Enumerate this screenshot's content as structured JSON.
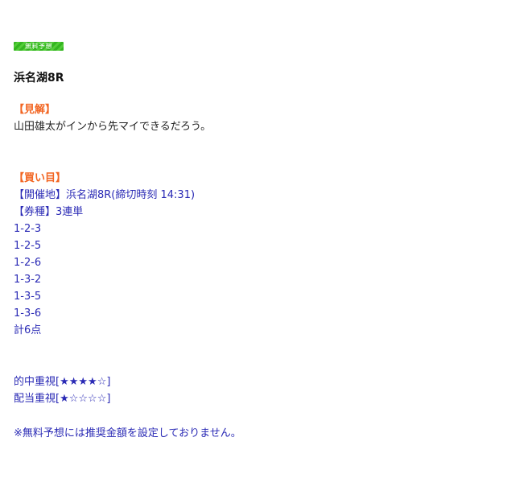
{
  "badge": {
    "label": "無料予想"
  },
  "race_title": "浜名湖8R",
  "colors": {
    "accent_orange": "#f26522",
    "text_blue": "#2a2ab5",
    "badge_green": "#3ebc26"
  },
  "opinion": {
    "heading": "【見解】",
    "text": "山田雄太がインから先マイできるだろう。"
  },
  "bets": {
    "heading": "【買い目】",
    "venue": "【開催地】浜名湖8R(締切時刻 14:31)",
    "ticket_type": "【券種】3連単",
    "combos": [
      "1-2-3",
      "1-2-5",
      "1-2-6",
      "1-3-2",
      "1-3-5",
      "1-3-6"
    ],
    "total": "計6点"
  },
  "ratings": {
    "hit_rate": "的中重視[★★★★☆]",
    "payout": "配当重視[★☆☆☆☆]"
  },
  "note": "※無料予想には推奨金額を設定しておりません。"
}
